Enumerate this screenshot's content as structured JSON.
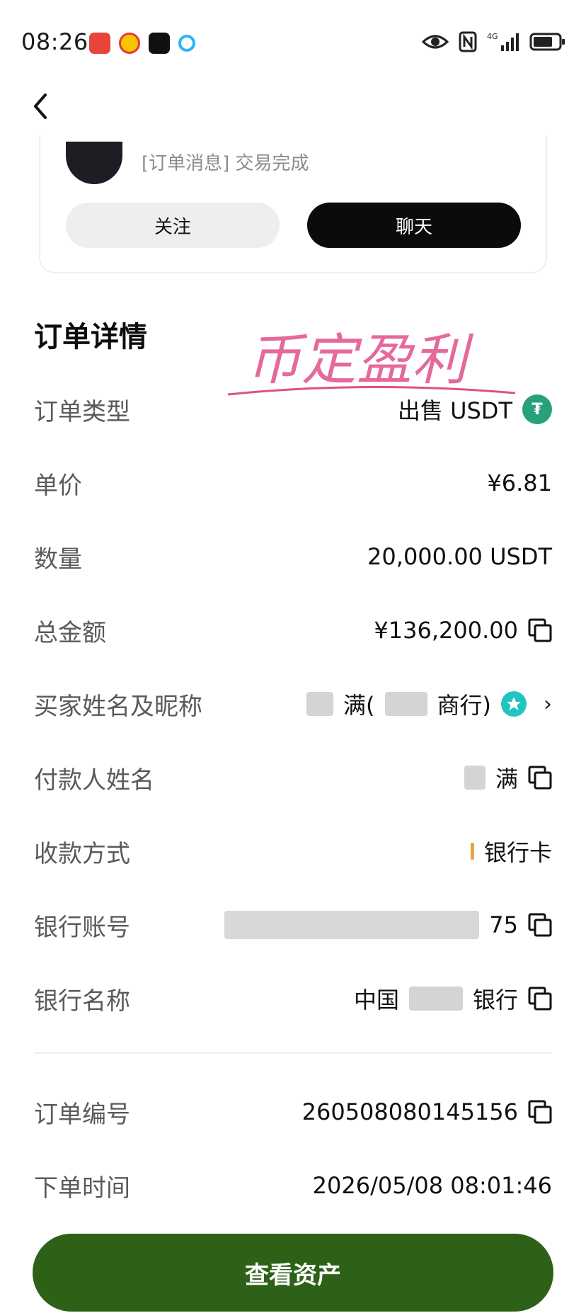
{
  "status_bar": {
    "time": "08:26",
    "network": "4G"
  },
  "card": {
    "message": "[订单消息] 交易完成",
    "follow_label": "关注",
    "chat_label": "聊天"
  },
  "section_title": "订单详情",
  "watermark_text": "币定盈利",
  "rows": {
    "order_type": {
      "label": "订单类型",
      "value": "出售 USDT",
      "badge": "₮"
    },
    "unit_price": {
      "label": "单价",
      "value": "¥6.81"
    },
    "quantity": {
      "label": "数量",
      "value": "20,000.00 USDT"
    },
    "total": {
      "label": "总金额",
      "value": "¥136,200.00"
    },
    "buyer": {
      "label": "买家姓名及昵称",
      "value_a": "满(",
      "value_b": "商行)"
    },
    "payer": {
      "label": "付款人姓名",
      "value": "满"
    },
    "payment": {
      "label": "收款方式",
      "value": "银行卡"
    },
    "account": {
      "label": "银行账号",
      "value": "75"
    },
    "bank": {
      "label": "银行名称",
      "value_a": "中国",
      "value_b": "银行"
    },
    "order_no": {
      "label": "订单编号",
      "value": "260508080145156"
    },
    "order_time": {
      "label": "下单时间",
      "value": "2026/05/08 08:01:46"
    }
  },
  "primary_button": "查看资产",
  "colors": {
    "primary": "#2d6117",
    "usdt": "#26a17b",
    "watermark": "#e04f8a"
  }
}
